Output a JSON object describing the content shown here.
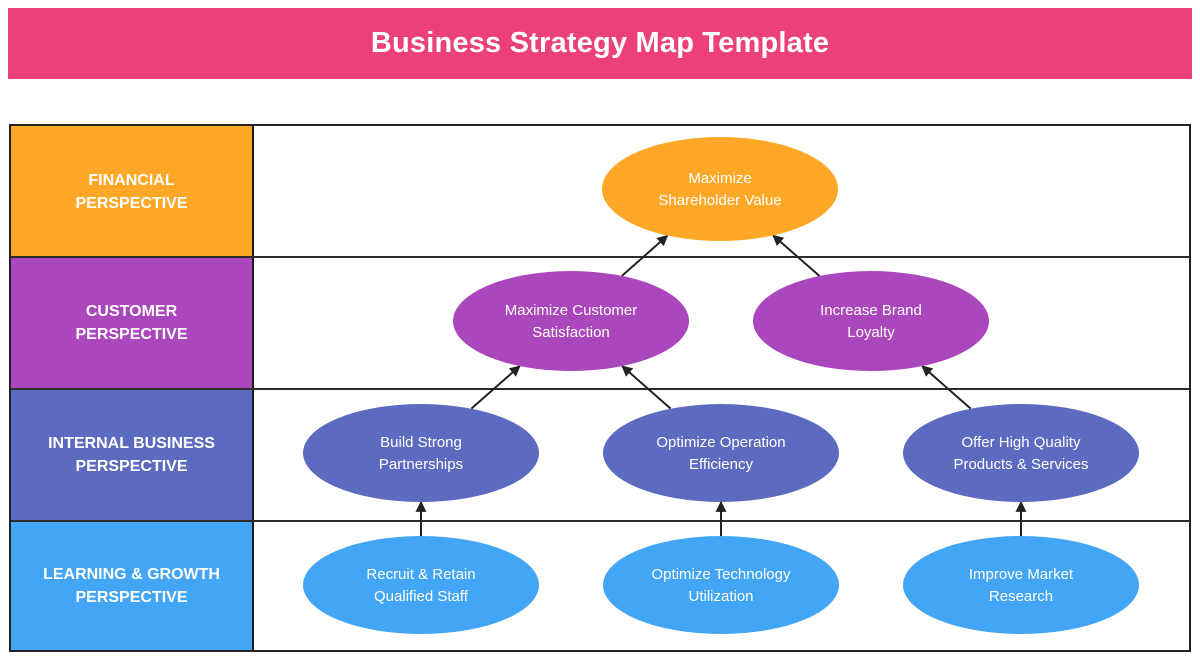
{
  "header": {
    "title": "Business Strategy Map Template",
    "color": "#EC407A"
  },
  "perspectives": [
    {
      "id": "financial",
      "label_lines": [
        "FINANCIAL",
        "PERSPECTIVE"
      ],
      "color": "#FFA726"
    },
    {
      "id": "customer",
      "label_lines": [
        "CUSTOMER",
        "PERSPECTIVE"
      ],
      "color": "#AB47BC"
    },
    {
      "id": "internal",
      "label_lines": [
        "INTERNAL BUSINESS",
        "PERSPECTIVE"
      ],
      "color": "#5C6BC0"
    },
    {
      "id": "learning",
      "label_lines": [
        "LEARNING & GROWTH",
        "PERSPECTIVE"
      ],
      "color": "#42A5F5"
    }
  ],
  "objectives": [
    {
      "id": "maximize-shareholder-value",
      "perspective": "financial",
      "lines": [
        "Maximize",
        "Shareholder Value"
      ]
    },
    {
      "id": "maximize-customer-satisfaction",
      "perspective": "customer",
      "lines": [
        "Maximize Customer",
        "Satisfaction"
      ]
    },
    {
      "id": "increase-brand-loyalty",
      "perspective": "customer",
      "lines": [
        "Increase Brand",
        "Loyalty"
      ]
    },
    {
      "id": "build-strong-partnerships",
      "perspective": "internal",
      "lines": [
        "Build Strong",
        "Partnerships"
      ]
    },
    {
      "id": "optimize-operation-efficiency",
      "perspective": "internal",
      "lines": [
        "Optimize Operation",
        "Efficiency"
      ]
    },
    {
      "id": "offer-high-quality-products",
      "perspective": "internal",
      "lines": [
        "Offer High Quality",
        "Products & Services"
      ]
    },
    {
      "id": "recruit-retain-staff",
      "perspective": "learning",
      "lines": [
        "Recruit & Retain",
        "Qualified Staff"
      ]
    },
    {
      "id": "optimize-technology-utilization",
      "perspective": "learning",
      "lines": [
        "Optimize Technology",
        "Utilization"
      ]
    },
    {
      "id": "improve-market-research",
      "perspective": "learning",
      "lines": [
        "Improve Market",
        "Research"
      ]
    }
  ],
  "links": [
    {
      "from": "maximize-customer-satisfaction",
      "to": "maximize-shareholder-value"
    },
    {
      "from": "increase-brand-loyalty",
      "to": "maximize-shareholder-value"
    },
    {
      "from": "build-strong-partnerships",
      "to": "maximize-customer-satisfaction"
    },
    {
      "from": "optimize-operation-efficiency",
      "to": "maximize-customer-satisfaction"
    },
    {
      "from": "offer-high-quality-products",
      "to": "increase-brand-loyalty"
    },
    {
      "from": "recruit-retain-staff",
      "to": "build-strong-partnerships"
    },
    {
      "from": "optimize-technology-utilization",
      "to": "optimize-operation-efficiency"
    },
    {
      "from": "improve-market-research",
      "to": "offer-high-quality-products"
    }
  ]
}
